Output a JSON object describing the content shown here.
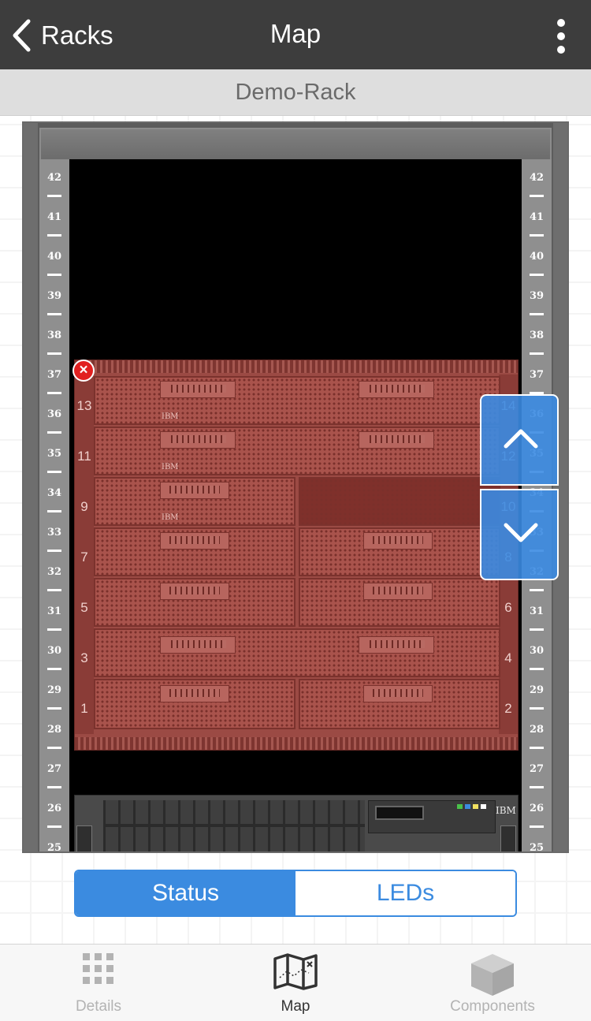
{
  "nav": {
    "back_label": "Racks",
    "title": "Map"
  },
  "rack": {
    "name": "Demo-Rack",
    "u_labels": [
      "42",
      "41",
      "40",
      "39",
      "38",
      "37",
      "36",
      "35",
      "34",
      "33",
      "32",
      "31",
      "30",
      "29",
      "28",
      "27",
      "26",
      "25"
    ],
    "chassis_slots_left": [
      "13",
      "11",
      "9",
      "7",
      "5",
      "3",
      "1"
    ],
    "chassis_slots_right": [
      "14",
      "12",
      "10",
      "8",
      "6",
      "4",
      "2"
    ],
    "chassis_brand": "IBM",
    "server_brand": "IBM"
  },
  "segmented": {
    "status_label": "Status",
    "leds_label": "LEDs"
  },
  "tabs": [
    {
      "label": "Details",
      "icon": "grid-icon"
    },
    {
      "label": "Map",
      "icon": "map-icon"
    },
    {
      "label": "Components",
      "icon": "cube-icon"
    }
  ],
  "colors": {
    "nav_bg": "#3d3d3d",
    "accent": "#3b8be0",
    "chassis_red": "#9b4a44",
    "close_red": "#e12020",
    "tab_active": "#333333",
    "tab_inactive": "#b3b3b3"
  }
}
